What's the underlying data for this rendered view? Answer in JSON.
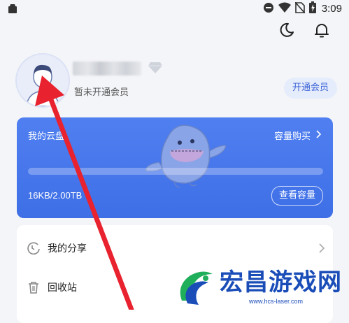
{
  "status_bar": {
    "time": "3:09",
    "icons": [
      "shopping-bag-icon",
      "do-not-disturb-icon",
      "wifi-icon",
      "no-sim-icon",
      "battery-icon"
    ]
  },
  "header_icons": [
    "moon-icon",
    "bell-icon"
  ],
  "profile": {
    "member_status": "暂未开通会员",
    "open_vip_button": "开通会员",
    "avatar_icon": "user-avatar-icon",
    "badge_icon": "diamond-icon"
  },
  "cloud_card": {
    "title": "我的云盘",
    "buy_link": "容量购买",
    "usage_text": "16KB/2.00TB",
    "usage_fraction": 0.0,
    "view_button": "查看容量",
    "accent_color": "#4a78ee"
  },
  "menu": {
    "items": [
      {
        "label": "我的分享",
        "icon": "share-icon"
      },
      {
        "label": "回收站",
        "icon": "trash-icon"
      }
    ]
  },
  "watermark": {
    "title": "宏昌游戏网",
    "url": "www.hcs-laser.com"
  },
  "annotation": {
    "arrow_color": "#e8222e"
  }
}
